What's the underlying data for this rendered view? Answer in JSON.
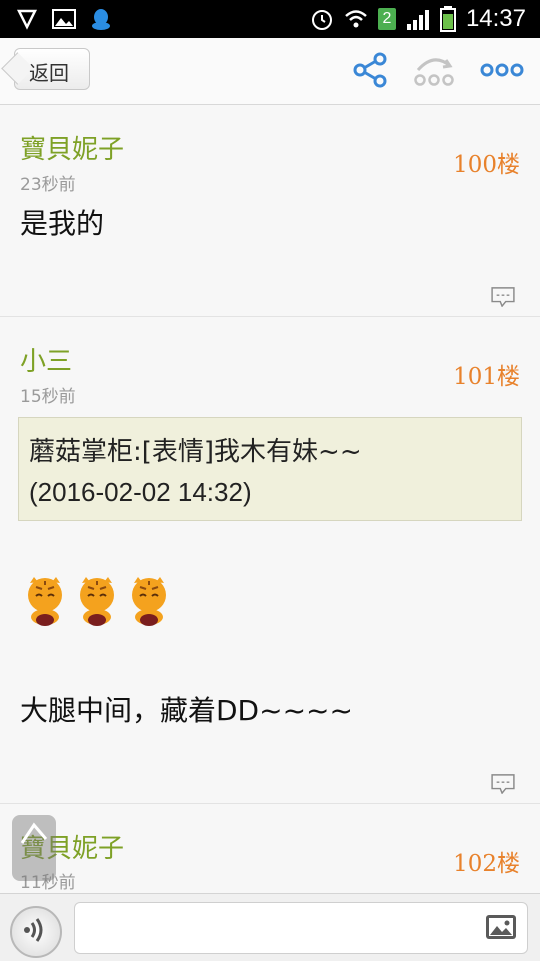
{
  "status_bar": {
    "time": "14:37",
    "sim_badge": "2",
    "icons": [
      "shield-icon",
      "image-icon",
      "qq-icon",
      "alarm-icon",
      "wifi-icon",
      "signal-icon",
      "battery-icon"
    ]
  },
  "nav": {
    "back_label": "返回",
    "icons": [
      "share-icon",
      "repost-icon",
      "more-icon"
    ],
    "accent": "#3a87d6"
  },
  "posts": [
    {
      "author": "寶貝妮子",
      "time": "23秒前",
      "floor": "100楼",
      "content": "是我的"
    },
    {
      "author": "小三",
      "time": "15秒前",
      "floor": "101楼",
      "quote": {
        "line1": "蘑菇掌柜:[表情]我木有妹~~",
        "line2": "(2016-02-02 14:32)"
      },
      "emoji": [
        "tiger-emoji",
        "tiger-emoji",
        "tiger-emoji"
      ],
      "content": "大腿中间，藏着DD~~~~"
    },
    {
      "author": "寶貝妮子",
      "time": "11秒前",
      "floor": "102楼"
    }
  ],
  "colors": {
    "author": "#7ea126",
    "floor": "#e8822c",
    "quote_bg": "#f0f0dc"
  }
}
